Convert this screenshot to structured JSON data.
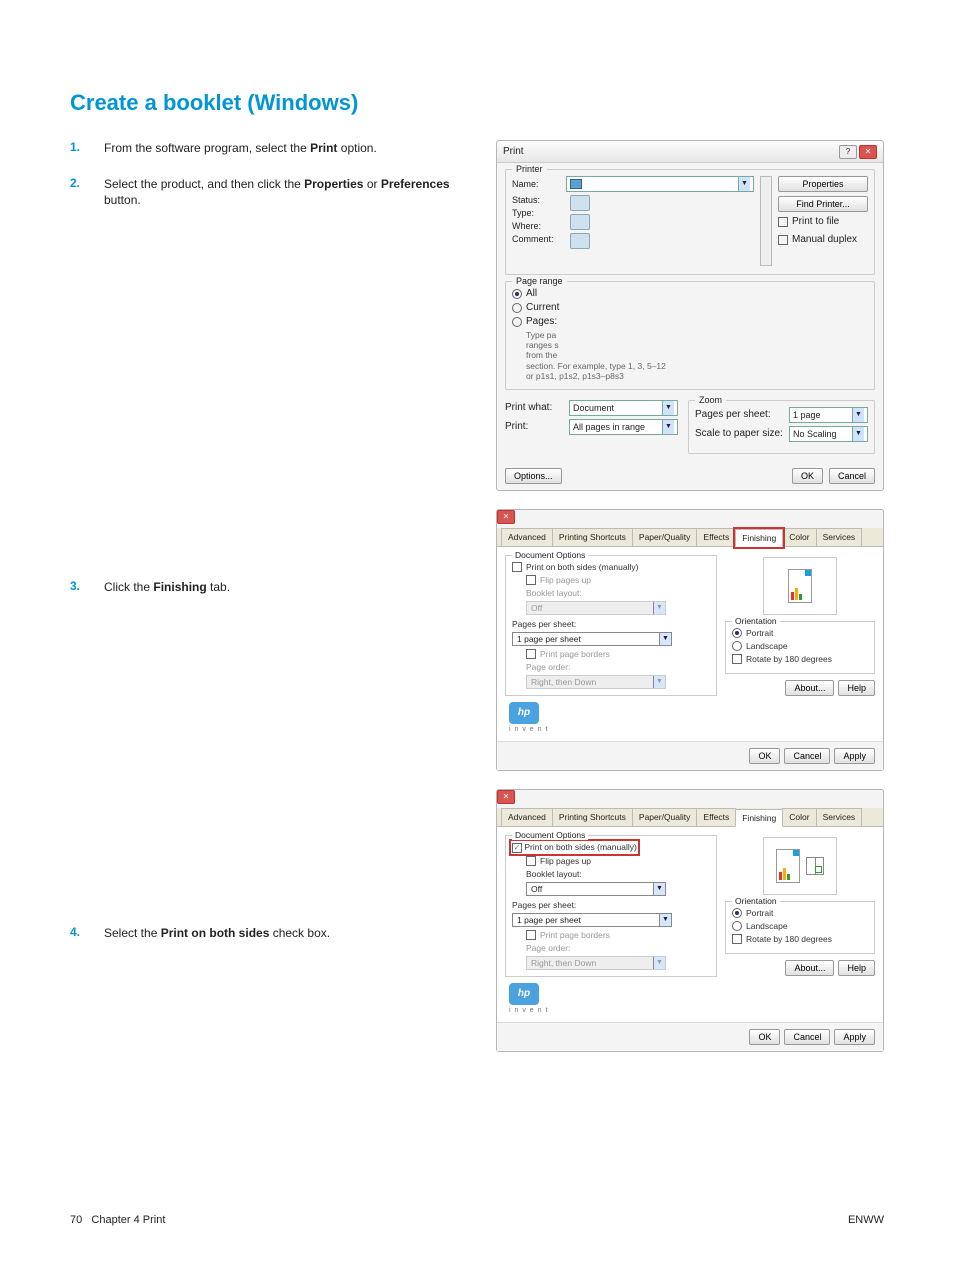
{
  "heading": "Create a booklet (Windows)",
  "steps": [
    {
      "num": "1.",
      "html": "From the software program, select the <b>Print</b> option."
    },
    {
      "num": "2.",
      "html": "Select the product, and then click the <b>Properties</b> or <b>Preferences</b> button."
    },
    {
      "num": "3.",
      "html": "Click the <b>Finishing</b> tab."
    },
    {
      "num": "4.",
      "html": "Select the <b>Print on both sides</b> check box."
    }
  ],
  "footer": {
    "page": "70",
    "chapter": "Chapter 4   Print",
    "right": "ENWW"
  },
  "print_dialog": {
    "title": "Print",
    "sections": {
      "printer": {
        "legend": "Printer",
        "name_label": "Name:",
        "status_label": "Status:",
        "type_label": "Type:",
        "where_label": "Where:",
        "comment_label": "Comment:",
        "buttons": {
          "properties": "Properties",
          "find_printer": "Find Printer...",
          "print_to_file": "Print to file",
          "manual_duplex": "Manual duplex"
        }
      },
      "page_range": {
        "legend": "Page range",
        "all": "All",
        "current": "Current",
        "pages": "Pages:",
        "hint1": "Type pa",
        "hint2": "ranges s",
        "hint3": "from the",
        "hint4": "section. For example, type 1, 3, 5–12",
        "hint5": "or p1s1, p1s2, p1s3–p8s3"
      },
      "print_what_label": "Print what:",
      "print_what_value": "Document",
      "print_label": "Print:",
      "print_value": "All pages in range",
      "zoom": {
        "legend": "Zoom",
        "pps_label": "Pages per sheet:",
        "pps_value": "1 page",
        "scale_label": "Scale to paper size:",
        "scale_value": "No Scaling"
      },
      "options_btn": "Options...",
      "ok": "OK",
      "cancel": "Cancel"
    }
  },
  "props_dialog": {
    "tabs": [
      "Advanced",
      "Printing Shortcuts",
      "Paper/Quality",
      "Effects",
      "Finishing",
      "Color",
      "Services"
    ],
    "doc_options_legend": "Document Options",
    "print_both_sides": "Print on both sides (manually)",
    "flip_pages_up": "Flip pages up",
    "booklet_layout": "Booklet layout:",
    "booklet_off": "Off",
    "pages_per_sheet": "Pages per sheet:",
    "pps_value": "1 page per sheet",
    "print_page_borders": "Print page borders",
    "page_order": "Page order:",
    "page_order_value": "Right, then Down",
    "orientation_legend": "Orientation",
    "portrait": "Portrait",
    "landscape": "Landscape",
    "rotate": "Rotate by 180 degrees",
    "about": "About...",
    "help": "Help",
    "ok": "OK",
    "cancel": "Cancel",
    "apply": "Apply",
    "invent": "i n v e n t"
  }
}
